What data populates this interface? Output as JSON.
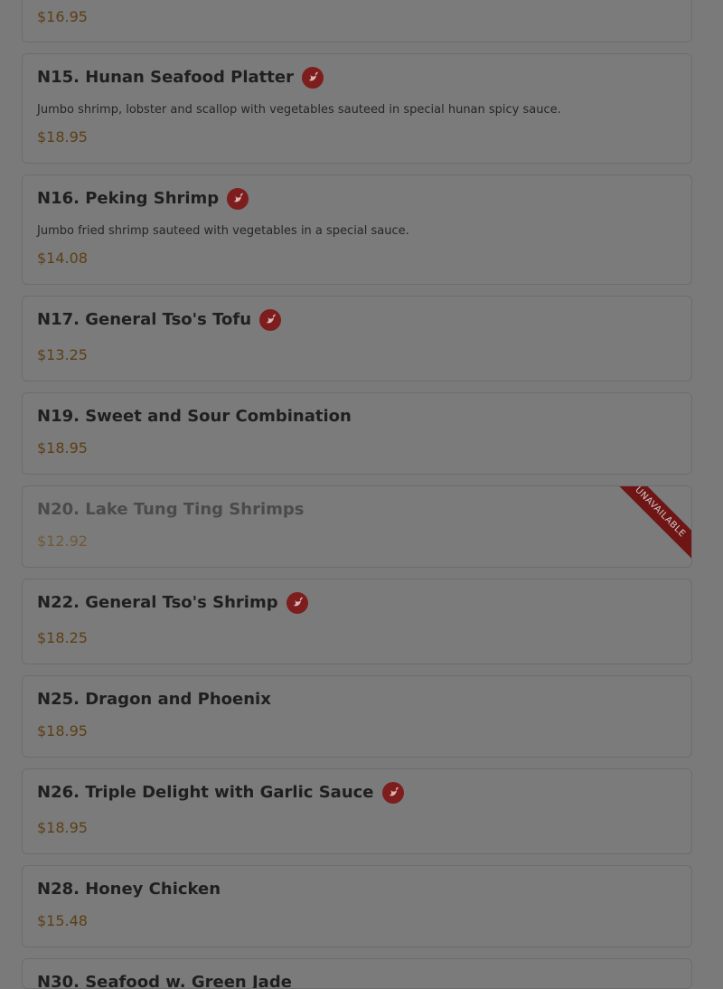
{
  "menu_items": [
    {
      "price": "$16.95"
    },
    {
      "title": "N15. Hunan Seafood Platter",
      "description": "Jumbo shrimp, lobster and scallop with vegetables sauteed in special hunan spicy sauce.",
      "price": "$18.95",
      "spicy": true
    },
    {
      "title": "N16. Peking Shrimp",
      "description": "Jumbo fried shrimp sauteed with vegetables in a special sauce.",
      "price": "$14.08",
      "spicy": true
    },
    {
      "title": "N17. General Tso's Tofu",
      "price": "$13.25",
      "spicy": true
    },
    {
      "title": "N19. Sweet and Sour Combination",
      "price": "$18.95"
    },
    {
      "title": "N20. Lake Tung Ting Shrimps",
      "price": "$12.92",
      "unavailable_label": "UNAVAILABLE"
    },
    {
      "title": "N22. General Tso's Shrimp",
      "price": "$18.25",
      "spicy": true
    },
    {
      "title": "N25. Dragon and Phoenix",
      "price": "$18.95"
    },
    {
      "title": "N26. Triple Delight with Garlic Sauce",
      "price": "$18.95",
      "spicy": true
    },
    {
      "title": "N28. Honey Chicken",
      "price": "$15.48"
    },
    {
      "title": "N30. Seafood w. Green Jade"
    }
  ]
}
